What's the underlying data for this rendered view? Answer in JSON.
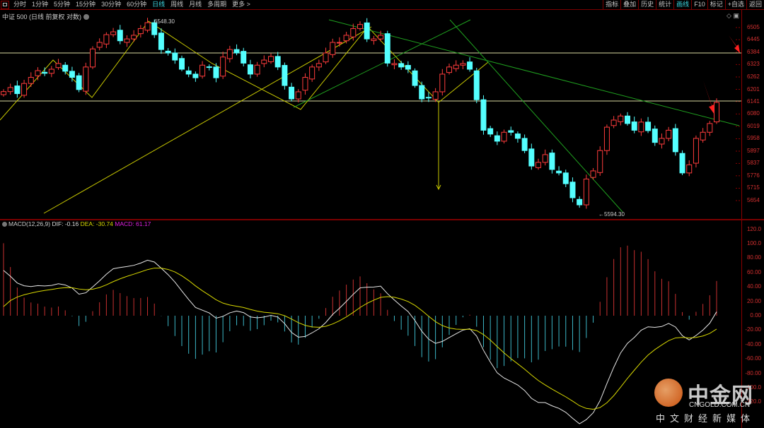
{
  "toolbar": {
    "periods": [
      "分时",
      "1分钟",
      "5分钟",
      "15分钟",
      "30分钟",
      "60分钟",
      "日线",
      "周线",
      "月线",
      "多周期",
      "更多 >"
    ],
    "active": "日线",
    "right": [
      "指标",
      "叠加",
      "历史",
      "统计",
      "画线",
      "F10",
      "标记",
      "+自选",
      "返回"
    ],
    "right_active": "画线"
  },
  "title": "中证 500 (日线 前复权 对数)",
  "price_axis": [
    "6505",
    "6445",
    "6384",
    "6323",
    "6262",
    "6201",
    "6141",
    "6080",
    "6019",
    "5958",
    "5897",
    "5837",
    "5776",
    "5715",
    "5654"
  ],
  "annotations": {
    "high": "6548.30",
    "low": "5594.30"
  },
  "macd_legend": {
    "name": "MACD(12,26,9)",
    "dif": "DIF: -0.16",
    "dea": "DEA: -30.74",
    "macd": "MACD: 61.17"
  },
  "macd_axis": [
    "120.0",
    "100.0",
    "80.00",
    "60.00",
    "40.00",
    "20.00",
    "0.00",
    "-20.00",
    "-40.00",
    "-60.00",
    "-80.00",
    "-100.0",
    "-120.0"
  ],
  "logo": {
    "main": "中金网",
    "url": "CNGOLD.COM.CN",
    "sub": "中文财经新媒体"
  },
  "colors": {
    "up": "#ff3c3c",
    "down": "#54ffff",
    "dif": "#e8e8e8",
    "dea": "#d8d800",
    "axis": "#d43030"
  },
  "chart_data": {
    "type": "candlestick",
    "title": "中证 500",
    "ylim": [
      5594.3,
      6548.3
    ],
    "closes": [
      6190,
      6210,
      6180,
      6230,
      6260,
      6293,
      6280,
      6300,
      6328,
      6290,
      6260,
      6200,
      6311,
      6400,
      6432,
      6470,
      6484,
      6440,
      6449,
      6467,
      6500,
      6529,
      6470,
      6397,
      6380,
      6345,
      6300,
      6276,
      6258,
      6320,
      6311,
      6258,
      6360,
      6397,
      6380,
      6330,
      6276,
      6320,
      6345,
      6363,
      6311,
      6220,
      6154,
      6189,
      6260,
      6311,
      6328,
      6380,
      6432,
      6432,
      6467,
      6500,
      6520,
      6449,
      6449,
      6467,
      6330,
      6328,
      6311,
      6300,
      6220,
      6154,
      6160,
      6189,
      6276,
      6311,
      6320,
      6328,
      6300,
      6150,
      6000,
      5981,
      5946,
      5990,
      5990,
      5960,
      5900,
      5824,
      5842,
      5880,
      5807,
      5790,
      5737,
      5668,
      5633,
      5760,
      5800,
      5900,
      6015,
      6050,
      6070,
      6033,
      6000,
      6040,
      5998,
      5940,
      5960,
      6000,
      5894,
      5790,
      5830,
      5960,
      5990,
      6033,
      6137
    ],
    "hlines": [
      6384,
      6141
    ]
  }
}
